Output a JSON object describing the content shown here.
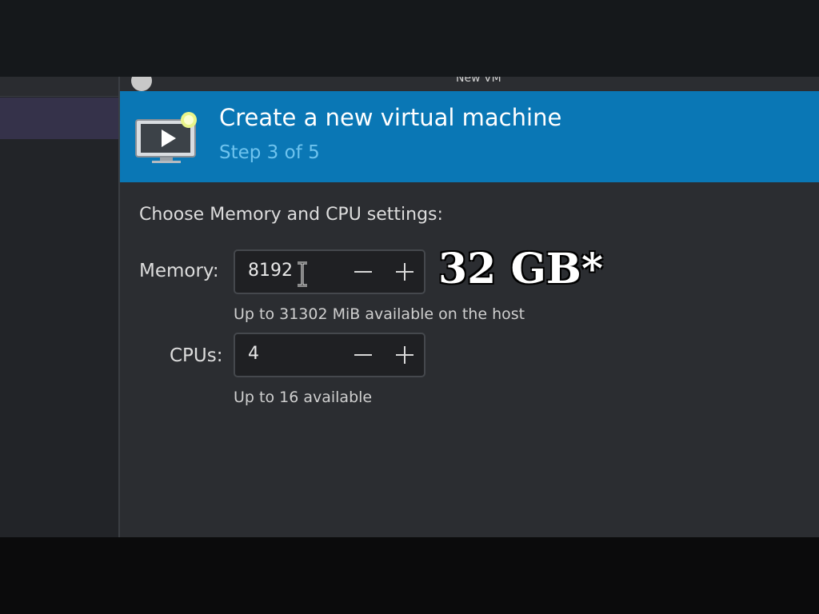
{
  "dialog": {
    "title": "New VM",
    "banner_title": "Create a new virtual machine",
    "step": "Step 3 of 5"
  },
  "section": {
    "heading": "Choose Memory and CPU settings:"
  },
  "memory": {
    "label": "Memory:",
    "value": "8192",
    "hint": "Up to 31302 MiB available on the host"
  },
  "cpus": {
    "label": "CPUs:",
    "value": "4",
    "hint": "Up to 16 available"
  },
  "overlay": {
    "note": "32 GB*"
  },
  "icons": {
    "vm": "vm-monitor-icon",
    "decrement": "minus-icon",
    "increment": "plus-icon",
    "cursor": "text-cursor-icon"
  },
  "colors": {
    "banner": "#0a77b5",
    "step_text": "#6ec3ee",
    "dialog_bg": "#2b2d31"
  }
}
